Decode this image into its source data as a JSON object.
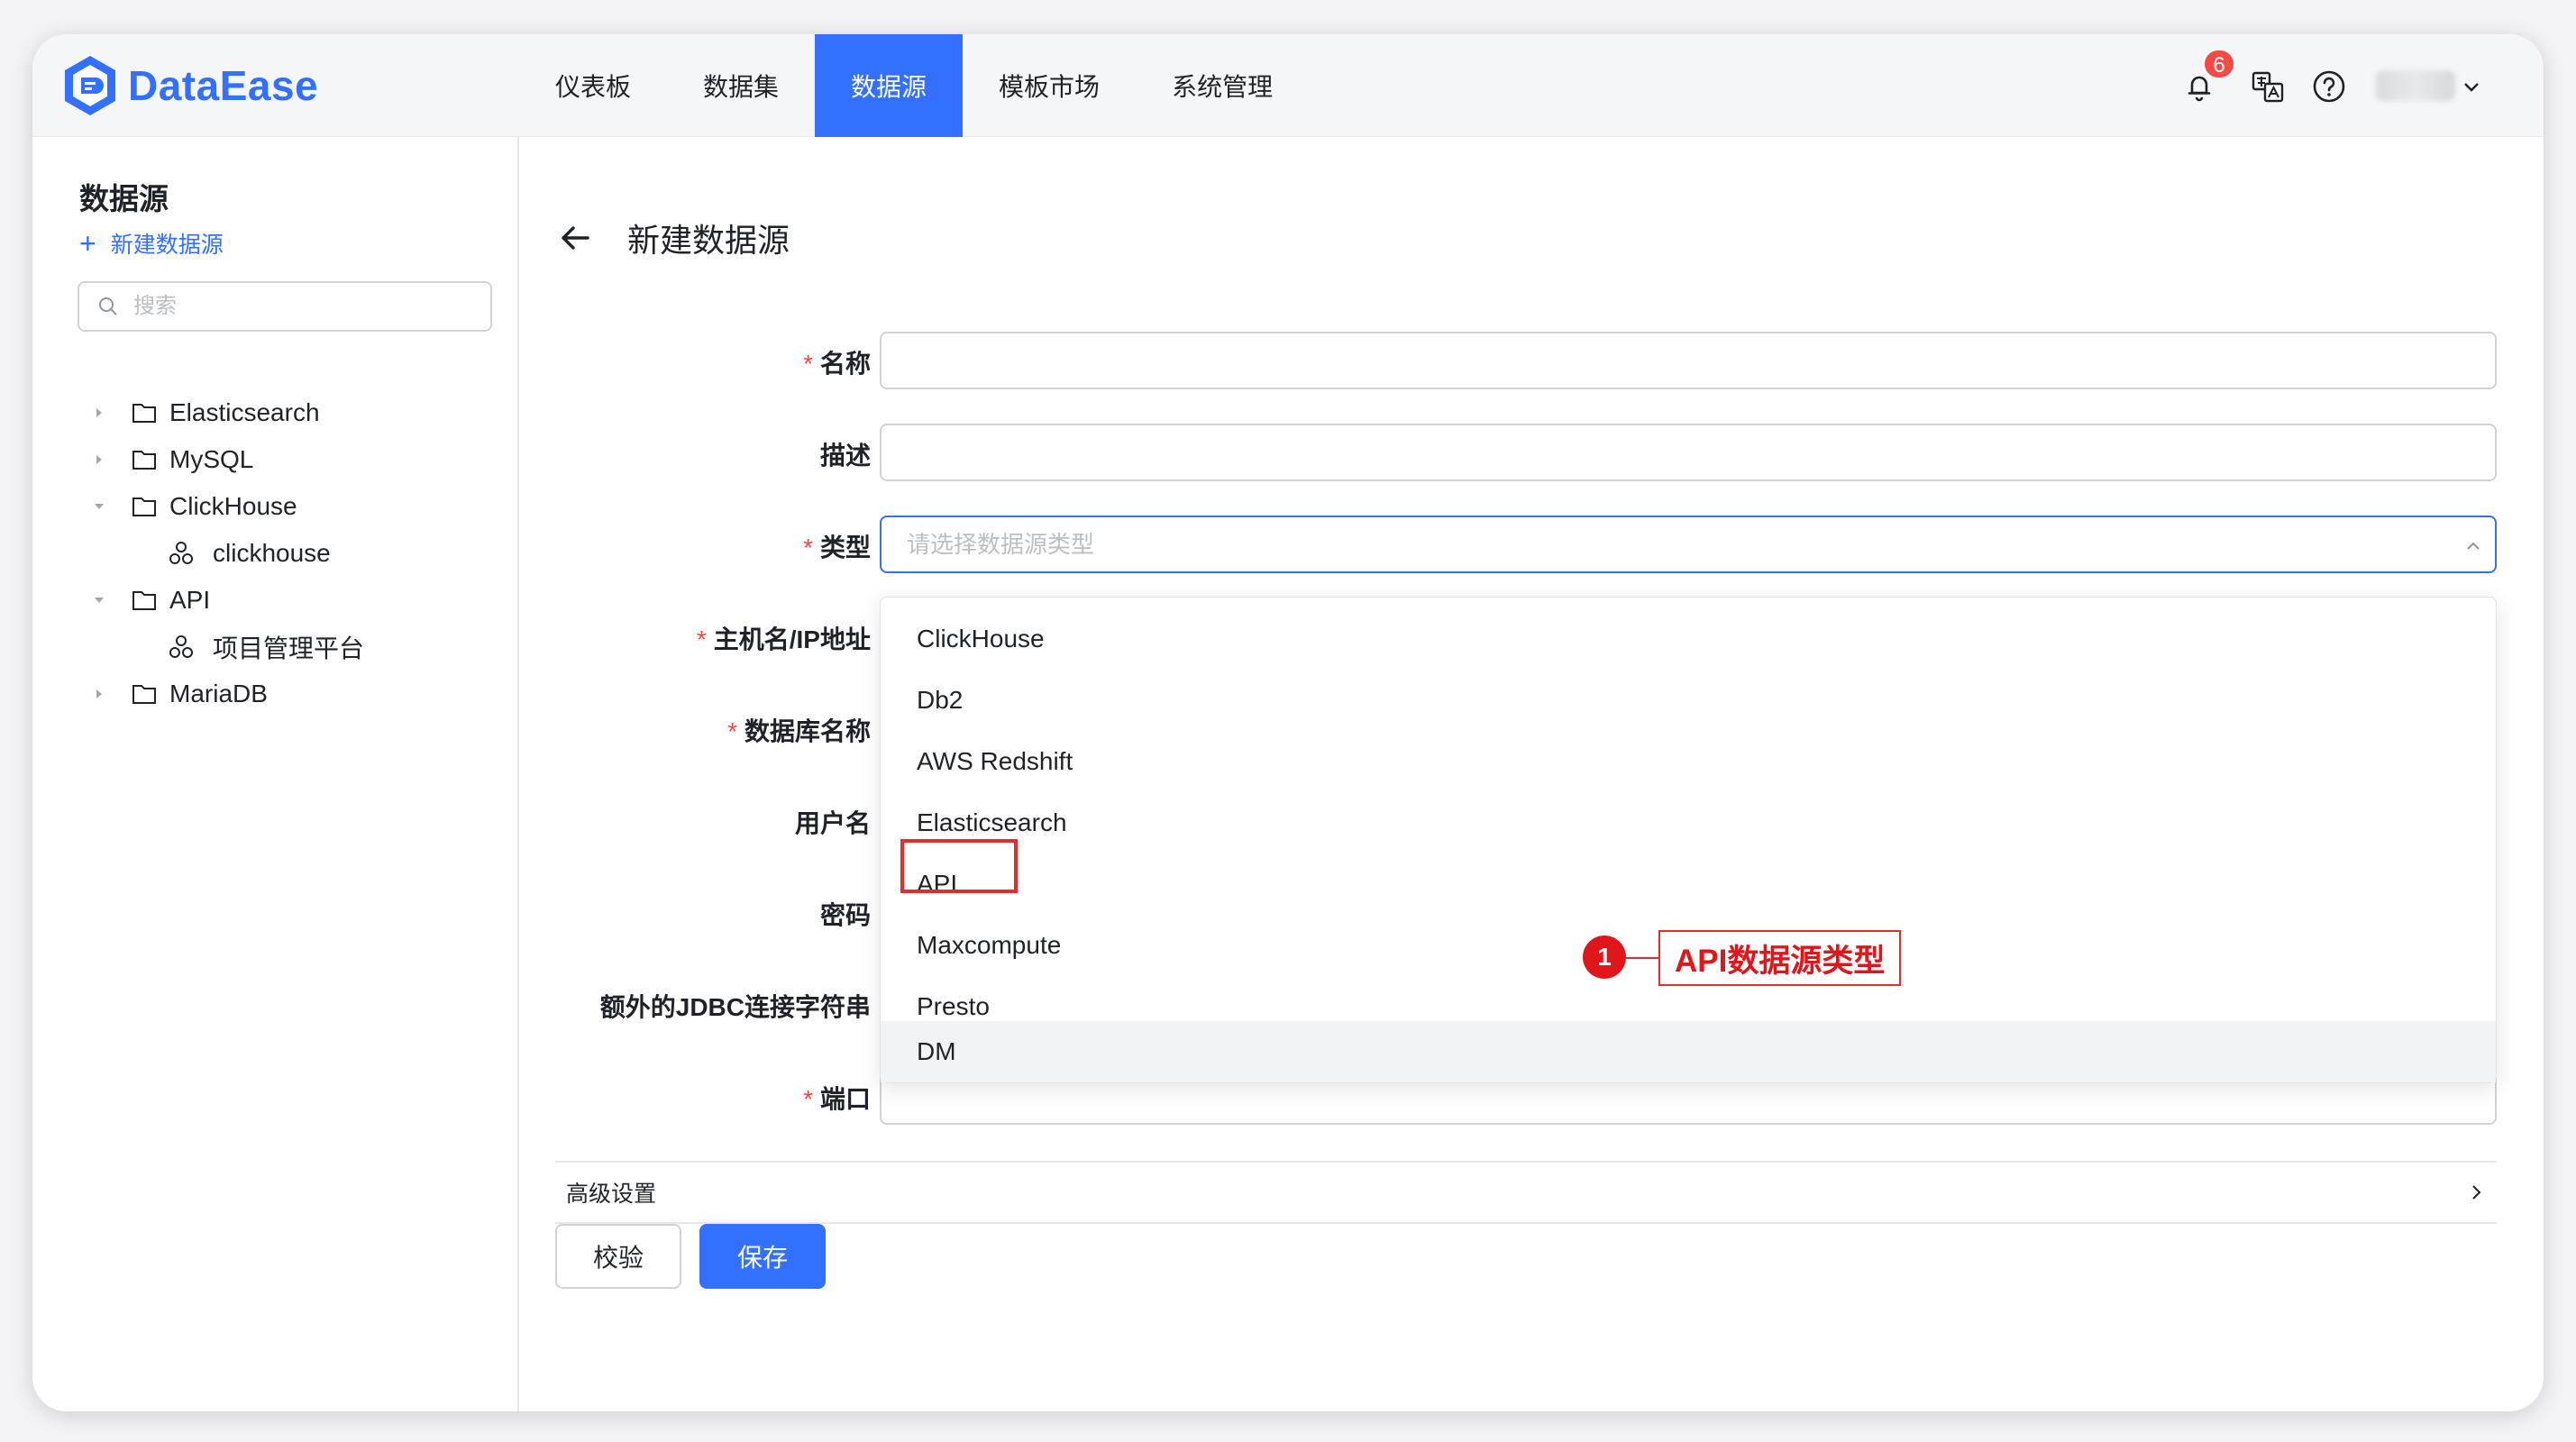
{
  "app": {
    "name": "DataEase"
  },
  "nav": {
    "items": [
      {
        "label": "仪表板"
      },
      {
        "label": "数据集"
      },
      {
        "label": "数据源"
      },
      {
        "label": "模板市场"
      },
      {
        "label": "系统管理"
      }
    ],
    "active_index": 2
  },
  "header": {
    "notification_count": "6",
    "icons": [
      "bell-icon",
      "translate-icon",
      "help-icon",
      "chevron-down-icon"
    ]
  },
  "sidebar": {
    "title": "数据源",
    "new_label": "新建数据源",
    "search_placeholder": "搜索",
    "tree": [
      {
        "label": "Elasticsearch",
        "type": "folder",
        "expanded": false
      },
      {
        "label": "MySQL",
        "type": "folder",
        "expanded": false
      },
      {
        "label": "ClickHouse",
        "type": "folder",
        "expanded": true
      },
      {
        "label": "clickhouse",
        "type": "datasource"
      },
      {
        "label": "API",
        "type": "folder",
        "expanded": true
      },
      {
        "label": "项目管理平台",
        "type": "datasource"
      },
      {
        "label": "MariaDB",
        "type": "folder",
        "expanded": false
      }
    ]
  },
  "form": {
    "title": "新建数据源",
    "labels": {
      "name": "名称",
      "description": "描述",
      "type": "类型",
      "host": "主机名/IP地址",
      "database": "数据库名称",
      "username": "用户名",
      "password": "密码",
      "jdbc": "额外的JDBC连接字符串",
      "port": "端口"
    },
    "required_marker": "*",
    "type_placeholder": "请选择数据源类型",
    "type_options": [
      "ClickHouse",
      "Db2",
      "AWS Redshift",
      "Elasticsearch",
      "API",
      "Maxcompute",
      "Presto",
      "DM"
    ],
    "highlighted_option": "API",
    "hovered_option": "DM",
    "advanced_label": "高级设置",
    "buttons": {
      "check": "校验",
      "save": "保存"
    }
  },
  "annotation": {
    "number": "1",
    "text": "API数据源类型"
  },
  "colors": {
    "primary": "#3370ff",
    "danger": "#e02e2e",
    "required": "#f54a45"
  }
}
